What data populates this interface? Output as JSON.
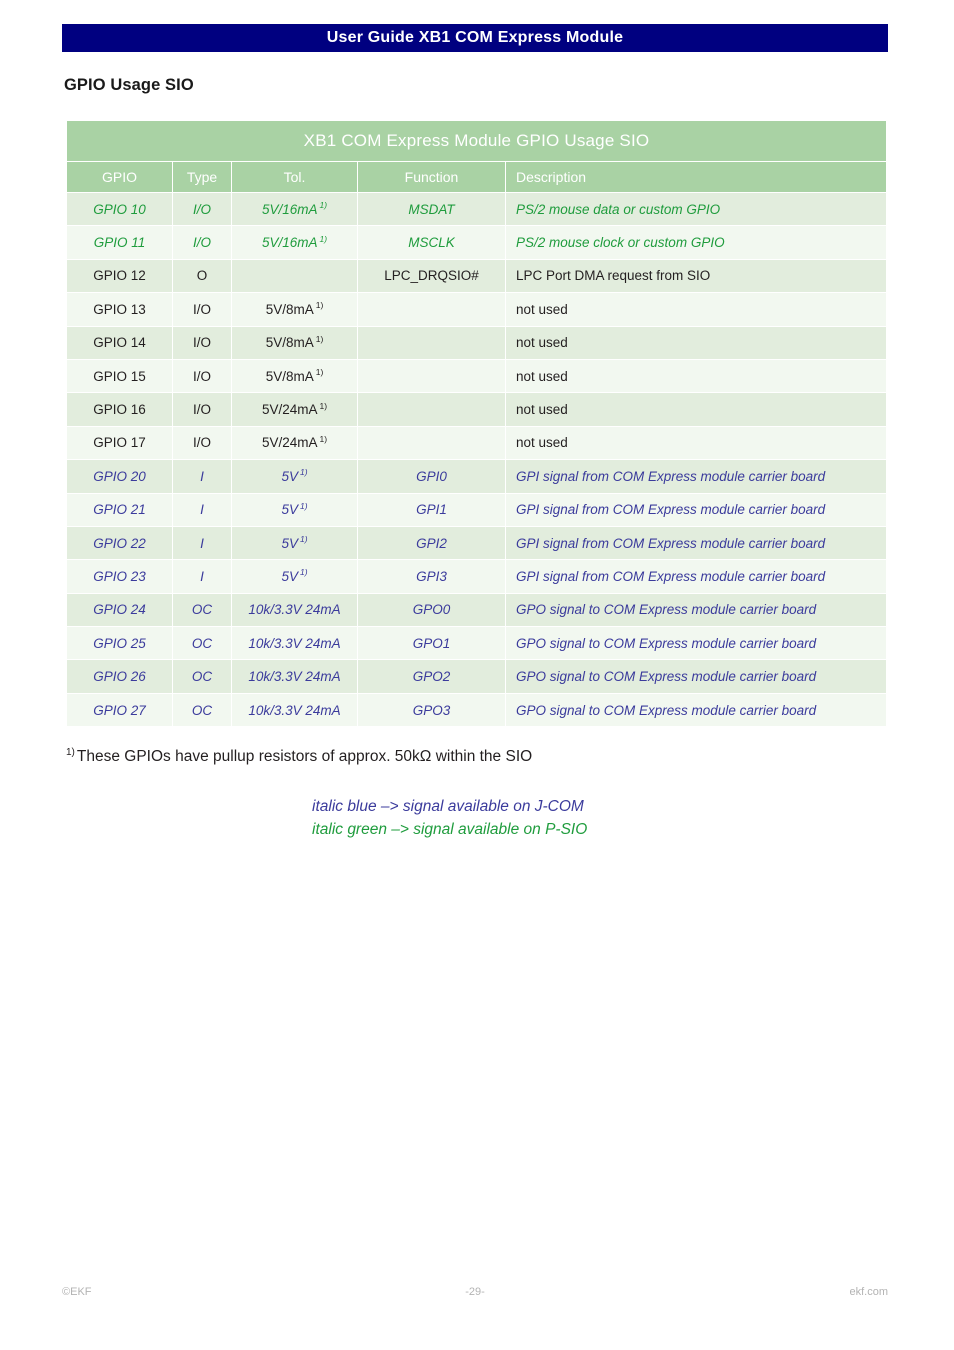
{
  "page_banner": {
    "title": "User Guide XB1 COM Express Module"
  },
  "section": {
    "title": "GPIO Usage SIO"
  },
  "table": {
    "caption": "XB1 COM Express Module GPIO Usage SIO",
    "columns": [
      "GPIO",
      "Type",
      "Tol.",
      "Function",
      "Description"
    ],
    "rows": [
      {
        "style": "green",
        "gpio": "GPIO 10",
        "type": "I/O",
        "tol": "5V/16mA",
        "tol_sup": "1)",
        "function": "MSDAT",
        "description": "PS/2 mouse data or custom GPIO"
      },
      {
        "style": "green",
        "gpio": "GPIO 11",
        "type": "I/O",
        "tol": "5V/16mA",
        "tol_sup": "1)",
        "function": "MSCLK",
        "description": "PS/2 mouse clock or custom GPIO"
      },
      {
        "style": "plain",
        "gpio": "GPIO 12",
        "type": "O",
        "tol": "",
        "tol_sup": "",
        "function": "LPC_DRQSIO#",
        "description": "LPC Port DMA request from SIO"
      },
      {
        "style": "plain",
        "gpio": "GPIO 13",
        "type": "I/O",
        "tol": "5V/8mA",
        "tol_sup": "1)",
        "function": "",
        "description": "not used"
      },
      {
        "style": "plain",
        "gpio": "GPIO 14",
        "type": "I/O",
        "tol": "5V/8mA",
        "tol_sup": "1)",
        "function": "",
        "description": "not used"
      },
      {
        "style": "plain",
        "gpio": "GPIO 15",
        "type": "I/O",
        "tol": "5V/8mA",
        "tol_sup": "1)",
        "function": "",
        "description": "not used"
      },
      {
        "style": "plain",
        "gpio": "GPIO 16",
        "type": "I/O",
        "tol": "5V/24mA",
        "tol_sup": "1)",
        "function": "",
        "description": "not used"
      },
      {
        "style": "plain",
        "gpio": "GPIO 17",
        "type": "I/O",
        "tol": "5V/24mA",
        "tol_sup": "1)",
        "function": "",
        "description": "not used"
      },
      {
        "style": "blue",
        "gpio": "GPIO 20",
        "type": "I",
        "tol": "5V",
        "tol_sup": "1)",
        "function": "GPI0",
        "description": "GPI signal from COM Express module carrier board"
      },
      {
        "style": "blue",
        "gpio": "GPIO 21",
        "type": "I",
        "tol": "5V",
        "tol_sup": "1)",
        "function": "GPI1",
        "description": "GPI signal from COM Express module carrier board"
      },
      {
        "style": "blue",
        "gpio": "GPIO 22",
        "type": "I",
        "tol": "5V",
        "tol_sup": "1)",
        "function": "GPI2",
        "description": "GPI signal from COM Express module carrier board"
      },
      {
        "style": "blue",
        "gpio": "GPIO 23",
        "type": "I",
        "tol": "5V",
        "tol_sup": "1)",
        "function": "GPI3",
        "description": "GPI signal from COM Express module carrier board"
      },
      {
        "style": "blue",
        "gpio": "GPIO 24",
        "type": "OC",
        "tol": "10k/3.3V 24mA",
        "tol_sup": "",
        "function": "GPO0",
        "description": "GPO signal to COM Express module carrier board"
      },
      {
        "style": "blue",
        "gpio": "GPIO 25",
        "type": "OC",
        "tol": "10k/3.3V 24mA",
        "tol_sup": "",
        "function": "GPO1",
        "description": "GPO signal to COM Express module carrier board"
      },
      {
        "style": "blue",
        "gpio": "GPIO 26",
        "type": "OC",
        "tol": "10k/3.3V 24mA",
        "tol_sup": "",
        "function": "GPO2",
        "description": "GPO signal to COM Express module carrier board"
      },
      {
        "style": "blue",
        "gpio": "GPIO 27",
        "type": "OC",
        "tol": "10k/3.3V 24mA",
        "tol_sup": "",
        "function": "GPO3",
        "description": "GPO signal to COM Express module carrier board"
      }
    ]
  },
  "footnote": {
    "marker": "1)",
    "text": "These GPIOs have pullup resistors of approx. 50kΩ within the SIO"
  },
  "legend": {
    "blue": "italic blue –>  signal available on J-COM",
    "green": "italic green –>  signal available on P-SIO"
  },
  "footer": {
    "left": "©EKF",
    "center": "-29-",
    "right": "ekf.com"
  },
  "colors": {
    "banner_navy": "#000080",
    "table_header_green": "#a9d2a4",
    "row_shade_a": "#e2eddd",
    "row_shade_b": "#f2f8f0",
    "text_green": "#1f9c3d",
    "text_blue": "#3b3b9c",
    "footer_gray": "#b3b3b3"
  }
}
